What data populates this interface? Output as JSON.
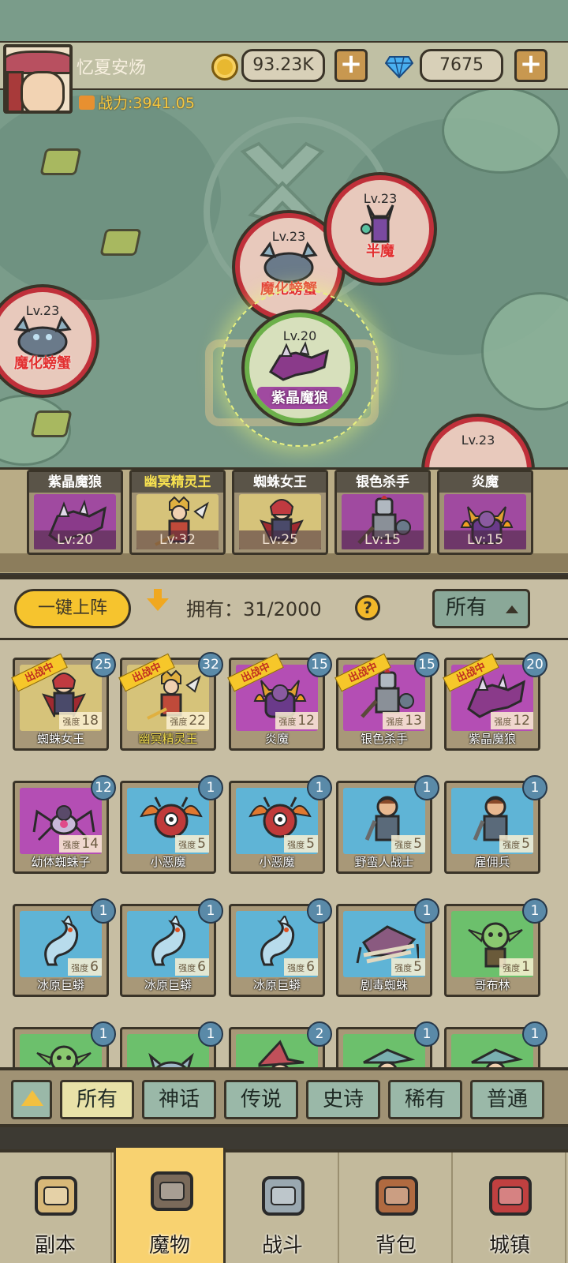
{
  "player": {
    "name": "忆夏安炀",
    "power": "战力:3941.05",
    "coins": "93.23K",
    "gems": "7675",
    "plus": "+"
  },
  "map_nodes": [
    {
      "level": "Lv.23",
      "name": "魔化螃蟹",
      "variant": "crab"
    },
    {
      "level": "Lv.23",
      "name": "魔化螃蟹",
      "variant": "crab"
    },
    {
      "level": "Lv.23",
      "name": "半魔",
      "variant": "demon"
    },
    {
      "level": "Lv.20",
      "name": "紫晶魔狼",
      "variant": "wolf",
      "current": true
    },
    {
      "level": "Lv.23",
      "name": "",
      "variant": "unknown"
    }
  ],
  "lineup": [
    {
      "name": "紫晶魔狼",
      "level": "Lv:20",
      "gold": false,
      "bg": "#a04aa0"
    },
    {
      "name": "幽冥精灵王",
      "level": "Lv:32",
      "gold": true,
      "bg": "#d6c37a"
    },
    {
      "name": "蜘蛛女王",
      "level": "Lv:25",
      "gold": false,
      "bg": "#d6c37a"
    },
    {
      "name": "银色杀手",
      "level": "Lv:15",
      "gold": false,
      "bg": "#a04aa0"
    },
    {
      "name": "炎魔",
      "level": "Lv:15",
      "gold": false,
      "bg": "#a04aa0"
    }
  ],
  "panel": {
    "deploy_label": "一键上阵",
    "own_label": "拥有：31/2000",
    "filter_selected": "所有",
    "help": "?"
  },
  "monsters": [
    {
      "name": "蜘蛛女王",
      "count": "25",
      "strength": "18",
      "in_battle": true,
      "gold": false,
      "bg": "#d6c37a"
    },
    {
      "name": "幽冥精灵王",
      "count": "32",
      "strength": "22",
      "in_battle": true,
      "gold": true,
      "bg": "#d6c37a"
    },
    {
      "name": "炎魔",
      "count": "15",
      "strength": "12",
      "in_battle": true,
      "gold": false,
      "bg": "#b44eb4"
    },
    {
      "name": "银色杀手",
      "count": "15",
      "strength": "13",
      "in_battle": true,
      "gold": false,
      "bg": "#b44eb4"
    },
    {
      "name": "紫晶魔狼",
      "count": "20",
      "strength": "12",
      "in_battle": true,
      "gold": false,
      "bg": "#b44eb4"
    },
    {
      "name": "幼体蜘蛛子",
      "count": "12",
      "strength": "14",
      "in_battle": false,
      "gold": false,
      "bg": "#b44eb4"
    },
    {
      "name": "小恶魔",
      "count": "1",
      "strength": "5",
      "in_battle": false,
      "gold": false,
      "bg": "#5fb4d6"
    },
    {
      "name": "小恶魔",
      "count": "1",
      "strength": "5",
      "in_battle": false,
      "gold": false,
      "bg": "#5fb4d6"
    },
    {
      "name": "野蛮人战士",
      "count": "1",
      "strength": "5",
      "in_battle": false,
      "gold": false,
      "bg": "#5fb4d6"
    },
    {
      "name": "雇佣兵",
      "count": "1",
      "strength": "5",
      "in_battle": false,
      "gold": false,
      "bg": "#5fb4d6"
    },
    {
      "name": "冰原巨蟒",
      "count": "1",
      "strength": "6",
      "in_battle": false,
      "gold": false,
      "bg": "#5fb4d6"
    },
    {
      "name": "冰原巨蟒",
      "count": "1",
      "strength": "6",
      "in_battle": false,
      "gold": false,
      "bg": "#5fb4d6"
    },
    {
      "name": "冰原巨蟒",
      "count": "1",
      "strength": "6",
      "in_battle": false,
      "gold": false,
      "bg": "#5fb4d6"
    },
    {
      "name": "剧毒蜘蛛",
      "count": "1",
      "strength": "5",
      "in_battle": false,
      "gold": false,
      "bg": "#5fb4d6"
    },
    {
      "name": "哥布林",
      "count": "1",
      "strength": "1",
      "in_battle": false,
      "gold": false,
      "bg": "#6cc06c"
    },
    {
      "name": "",
      "count": "1",
      "strength": "",
      "in_battle": false,
      "gold": false,
      "bg": "#6cc06c"
    },
    {
      "name": "",
      "count": "1",
      "strength": "",
      "in_battle": false,
      "gold": false,
      "bg": "#6cc06c"
    },
    {
      "name": "",
      "count": "2",
      "strength": "",
      "in_battle": false,
      "gold": false,
      "bg": "#6cc06c"
    },
    {
      "name": "",
      "count": "1",
      "strength": "",
      "in_battle": false,
      "gold": false,
      "bg": "#6cc06c"
    },
    {
      "name": "",
      "count": "1",
      "strength": "",
      "in_battle": false,
      "gold": false,
      "bg": "#6cc06c"
    }
  ],
  "labels": {
    "strength": "强度",
    "in_battle": "出战中"
  },
  "rarity_filters": [
    {
      "label": "所有",
      "active": true
    },
    {
      "label": "神话",
      "active": false
    },
    {
      "label": "传说",
      "active": false
    },
    {
      "label": "史诗",
      "active": false
    },
    {
      "label": "稀有",
      "active": false
    },
    {
      "label": "普通",
      "active": false
    }
  ],
  "nav": [
    {
      "label": "副本",
      "icon": "map-scroll-icon",
      "active": false
    },
    {
      "label": "魔物",
      "icon": "monster-helmet-icon",
      "active": true
    },
    {
      "label": "战斗",
      "icon": "crossed-swords-icon",
      "active": false
    },
    {
      "label": "背包",
      "icon": "backpack-icon",
      "active": false
    },
    {
      "label": "城镇",
      "icon": "shop-building-icon",
      "active": false
    }
  ]
}
